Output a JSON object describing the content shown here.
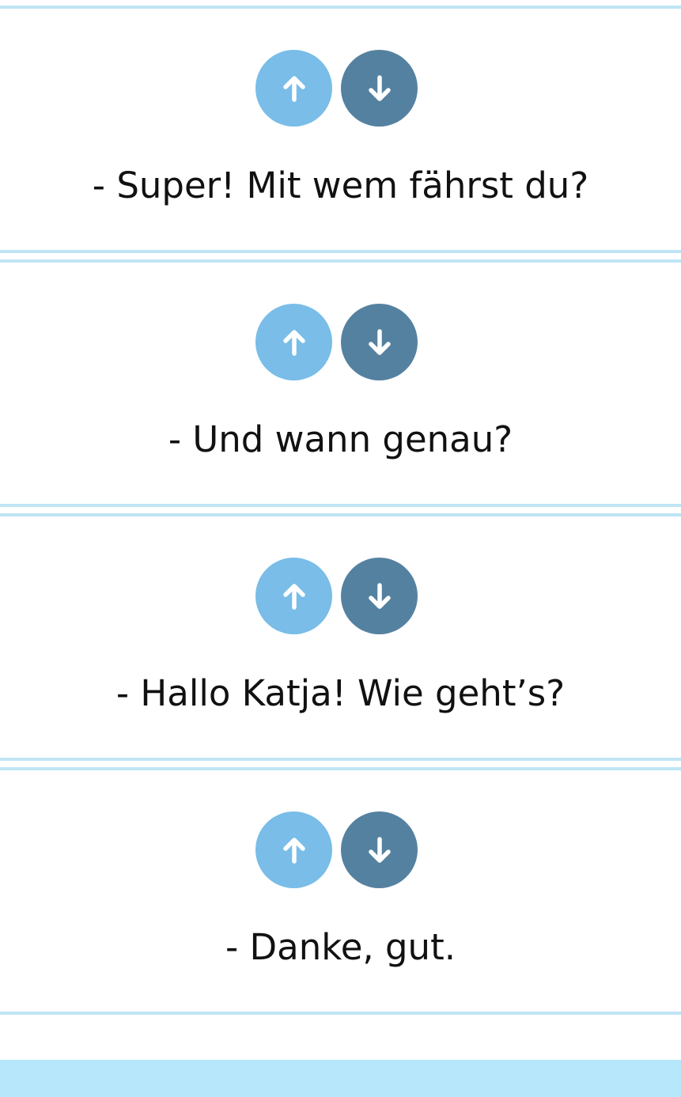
{
  "colors": {
    "up_button": "#79bde8",
    "down_button": "#5581a0",
    "arrow": "#ffffff",
    "divider": "#bfe5f5",
    "footer_bar": "#b6e7fb",
    "text": "#111111"
  },
  "icons": {
    "up": "arrow-up-icon",
    "down": "arrow-down-icon"
  },
  "lines": [
    {
      "text": "- Super! Mit wem fährst du?"
    },
    {
      "text": "- Und wann genau?"
    },
    {
      "text": "- Hallo Katja! Wie geht’s?"
    },
    {
      "text": "- Danke, gut."
    }
  ]
}
